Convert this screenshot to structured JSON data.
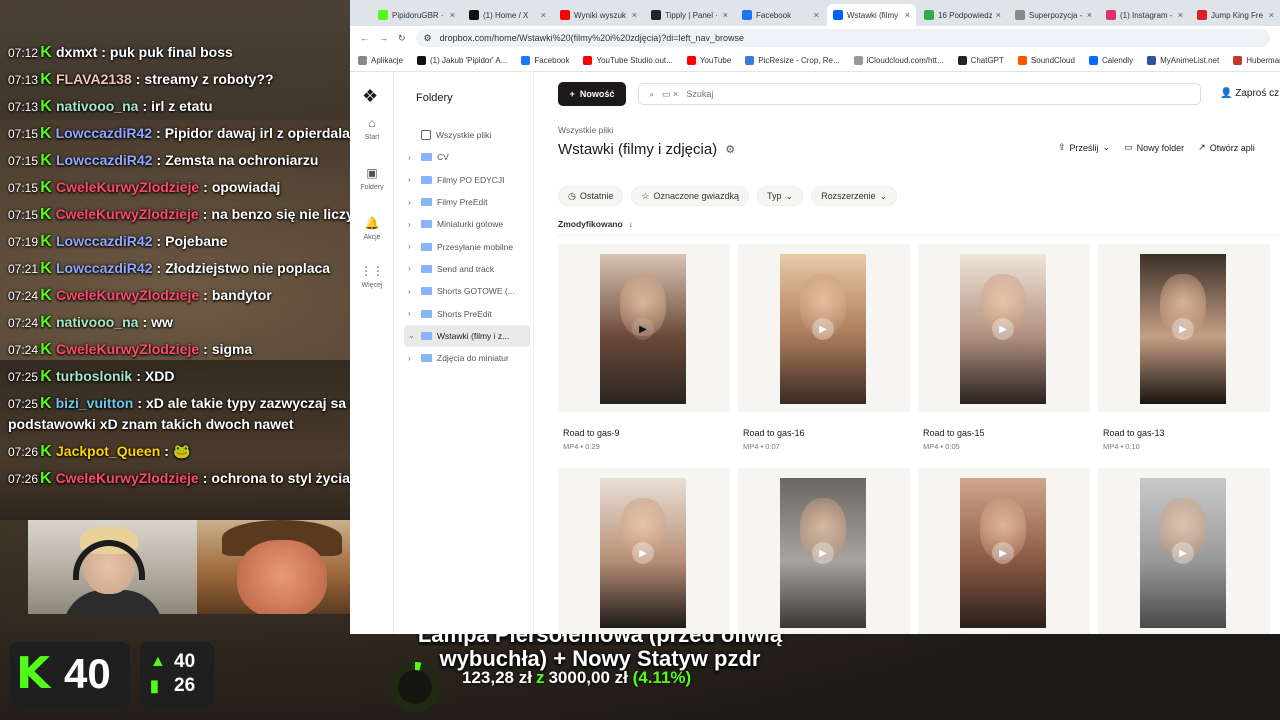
{
  "chat": {
    "messages": [
      {
        "time": "07:12",
        "user": "dxmxt",
        "color": "#ffffff",
        "text": "puk puk final boss"
      },
      {
        "time": "07:13",
        "user": "FLAVA2138",
        "color": "#f0c7b4",
        "text": "streamy z roboty??"
      },
      {
        "time": "07:13",
        "user": "nativooo_na",
        "color": "#a6e6c9",
        "text": "irl z etatu"
      },
      {
        "time": "07:15",
        "user": "LowccazdiR42",
        "color": "#8fa8ff",
        "text": "Pipidor dawaj irl z opierdalani"
      },
      {
        "time": "07:15",
        "user": "LowccazdiR42",
        "color": "#8fa8ff",
        "text": "Zemsta na ochroniarzu"
      },
      {
        "time": "07:15",
        "user": "CweleKurwyZlodzieje",
        "color": "#ff4a6a",
        "text": "opowiadaj"
      },
      {
        "time": "07:15",
        "user": "CweleKurwyZlodzieje",
        "color": "#ff4a6a",
        "text": "na benzo się nie liczy"
      },
      {
        "time": "07:19",
        "user": "LowccazdiR42",
        "color": "#8fa8ff",
        "text": "Pojebane"
      },
      {
        "time": "07:21",
        "user": "LowccazdiR42",
        "color": "#8fa8ff",
        "text": "Złodziejstwo nie poplaca"
      },
      {
        "time": "07:24",
        "user": "CweleKurwyZlodzieje",
        "color": "#ff4a6a",
        "text": "bandytor"
      },
      {
        "time": "07:24",
        "user": "nativooo_na",
        "color": "#a6e6c9",
        "text": "ww"
      },
      {
        "time": "07:24",
        "user": "CweleKurwyZlodzieje",
        "color": "#ff4a6a",
        "text": "sigma"
      },
      {
        "time": "07:25",
        "user": "turboslonik",
        "color": "#a6e6c9",
        "text": "XDD"
      }
    ],
    "wrapped": {
      "time": "07:25",
      "user": "bizi_vuitton",
      "color": "#6ec8f0",
      "text": "xD ale takie typy zazwyczaj sa na",
      "cont": "podstawowki xD znam takich dwoch nawet"
    },
    "tail": [
      {
        "time": "07:26",
        "user": "Jackpot_Queen",
        "color": "#ffd400",
        "text": "🐸"
      },
      {
        "time": "07:26",
        "user": "CweleKurwyZlodzieje",
        "color": "#ff4a6a",
        "text": "ochrona to styl życia"
      }
    ]
  },
  "stats": {
    "viewers": "40",
    "followers_up": "40",
    "subs": "26",
    "kick_logo": "K"
  },
  "goal": {
    "title_line1": "Lampa Piersołemowa (przed oliwią",
    "title_line2": "wybuchła) + Nowy Statyw pzdr",
    "current": "123,28 zł",
    "separator": "z",
    "target": "3000,00 zł",
    "percent_text": "(4.11%)",
    "percent": 4.11
  },
  "browser": {
    "tabs": [
      {
        "label": "PipidoruGBR · K",
        "color": "#53fc18",
        "active": false
      },
      {
        "label": "(1) Home / X",
        "color": "#111111",
        "active": false
      },
      {
        "label": "Wyniki wyszuk",
        "color": "#ff0000",
        "active": false
      },
      {
        "label": "Tipply | Panel ·",
        "color": "#222222",
        "active": false
      },
      {
        "label": "Facebook",
        "color": "#1877f2",
        "active": false
      },
      {
        "label": "Wstawki (filmy",
        "color": "#0061fe",
        "active": true
      },
      {
        "label": "16 Podpowiedz",
        "color": "#34a853",
        "active": false
      },
      {
        "label": "Superpozycja -",
        "color": "#888888",
        "active": false
      },
      {
        "label": "(1) Instagram -",
        "color": "#e1306c",
        "active": false
      },
      {
        "label": "Jump King Fre",
        "color": "#e02020",
        "active": false
      }
    ],
    "close_glyph": "×",
    "url": "dropbox.com/home/Wstawki%20(filmy%20i%20zdjęcia)?di=left_nav_browse",
    "bookmarks": [
      {
        "label": "Aplikacje",
        "color": "#888888"
      },
      {
        "label": "(1) Jakub 'Pipidor' A...",
        "color": "#111111"
      },
      {
        "label": "Facebook",
        "color": "#1877f2"
      },
      {
        "label": "YouTube Studio.out...",
        "color": "#ff0000"
      },
      {
        "label": "YouTube",
        "color": "#ff0000"
      },
      {
        "label": "PicResize - Crop, Re...",
        "color": "#3a7bd5"
      },
      {
        "label": "iCloudcloud.com/htt...",
        "color": "#999999"
      },
      {
        "label": "ChatGPT",
        "color": "#222222"
      },
      {
        "label": "SoundCloud",
        "color": "#ff5500"
      },
      {
        "label": "Calendly",
        "color": "#006bff"
      },
      {
        "label": "MyAnimeList.net",
        "color": "#2e51a2"
      },
      {
        "label": "Huberman Lab Fu",
        "color": "#c0392b"
      }
    ]
  },
  "dropbox": {
    "rail": [
      {
        "icon": "⌂",
        "label": "Start"
      },
      {
        "icon": "▣",
        "label": "Foldery"
      },
      {
        "icon": "🔔",
        "label": "Akcje"
      },
      {
        "icon": "⋮⋮",
        "label": "Więcej"
      }
    ],
    "sidebar_title": "Foldery",
    "tree": [
      {
        "label": "Wszystkie pliki",
        "expanded": "",
        "active": false,
        "type": "all"
      },
      {
        "label": "CV",
        "expanded": "›",
        "active": false,
        "type": "folder"
      },
      {
        "label": "Filmy PO EDYCJI",
        "expanded": "›",
        "active": false,
        "type": "folder"
      },
      {
        "label": "Filmy PreEdit",
        "expanded": "›",
        "active": false,
        "type": "folder"
      },
      {
        "label": "Miniaturki gotowe",
        "expanded": "›",
        "active": false,
        "type": "folder"
      },
      {
        "label": "Przesyłanie mobilne",
        "expanded": "›",
        "active": false,
        "type": "folder"
      },
      {
        "label": "Send and track",
        "expanded": "›",
        "active": false,
        "type": "folder"
      },
      {
        "label": "Shorts GOTOWE (...",
        "expanded": "›",
        "active": false,
        "type": "folder"
      },
      {
        "label": "Shorts PreEdit",
        "expanded": "›",
        "active": false,
        "type": "folder"
      },
      {
        "label": "Wstawki (filmy i z...",
        "expanded": "⌄",
        "active": true,
        "type": "folder"
      },
      {
        "label": "Zdjęcia do miniatur",
        "expanded": "›",
        "active": false,
        "type": "folder"
      }
    ],
    "new_button": "Nowość",
    "search_placeholder": "Szukaj",
    "invite": "Zaproś cz",
    "breadcrumb": "Wszystkie pliki",
    "title": "Wstawki (filmy i zdjęcia)",
    "actions": [
      "Prześlij",
      "Nowy folder",
      "Otwórz apli"
    ],
    "filters": [
      "Ostatnie",
      "Oznaczone gwiazdką",
      "Typ",
      "Rozszerzenie"
    ],
    "sort_label": "Zmodyfikowano",
    "files": [
      {
        "name": "Road to gas-9",
        "meta": "MP4 • 0:29",
        "tone": [
          "#d9c3b3",
          "#6a4a3a",
          "#2a2420"
        ]
      },
      {
        "name": "Road to gas-16",
        "meta": "MP4 • 0:07",
        "tone": [
          "#e9c9a9",
          "#a97a5a",
          "#3a2a24"
        ]
      },
      {
        "name": "Road to gas-15",
        "meta": "MP4 • 0:05",
        "tone": [
          "#f0e4d9",
          "#b09080",
          "#2a2220"
        ]
      },
      {
        "name": "Road to gas-13",
        "meta": "MP4 • 0:10",
        "tone": [
          "#3a3028",
          "#c79f85",
          "#1a1512"
        ]
      },
      {
        "name": "",
        "meta": "",
        "tone": [
          "#e8dfd6",
          "#b88f77",
          "#1e1a18"
        ]
      },
      {
        "name": "",
        "meta": "",
        "tone": [
          "#6a6660",
          "#a8a49e",
          "#3a3834"
        ]
      },
      {
        "name": "",
        "meta": "",
        "tone": [
          "#cfa88c",
          "#8a5a44",
          "#2a1f1a"
        ]
      },
      {
        "name": "",
        "meta": "",
        "tone": [
          "#c9c9c9",
          "#9a9a9a",
          "#4a4a4a"
        ]
      }
    ]
  },
  "colors": {
    "kick_green": "#53fc18",
    "dropbox_dark": "#1e1919"
  }
}
